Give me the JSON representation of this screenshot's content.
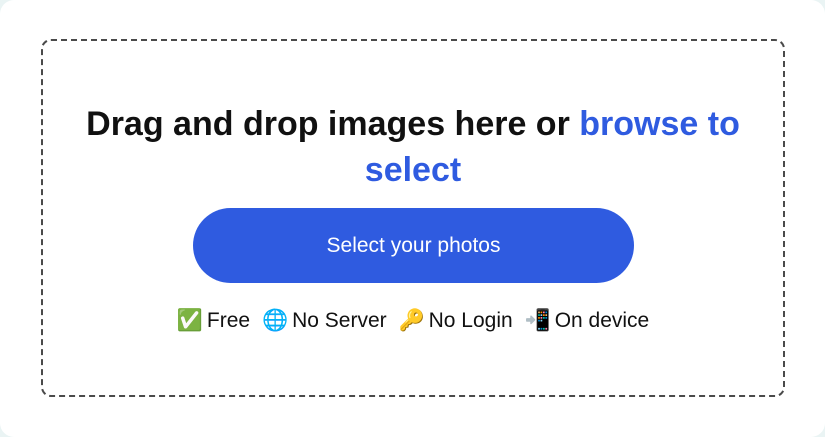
{
  "dropzone": {
    "headline_text": "Drag and drop images here or ",
    "browse_link": "browse to select",
    "button_label": "Select your photos"
  },
  "features": [
    {
      "icon": "check-mark-icon",
      "glyph": "✅",
      "label": "Free"
    },
    {
      "icon": "globe-icon",
      "glyph": "🌐",
      "label": "No Server"
    },
    {
      "icon": "key-icon",
      "glyph": "🔑",
      "label": "No Login"
    },
    {
      "icon": "mobile-phone-icon",
      "glyph": "📲",
      "label": "On device"
    }
  ],
  "colors": {
    "accent": "#2f5be0",
    "border": "#4a4a4a",
    "background": "#eaf4f4"
  }
}
